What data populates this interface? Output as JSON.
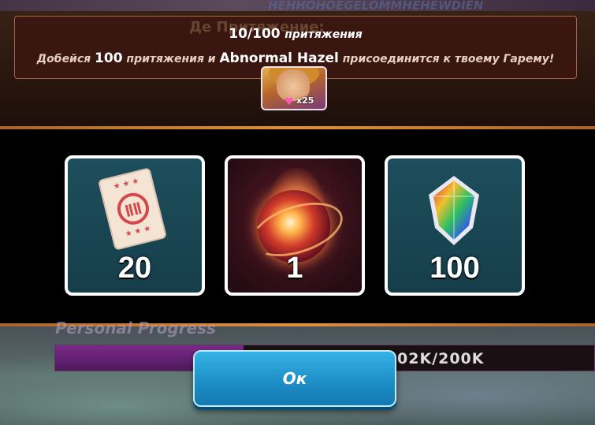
{
  "background": {
    "header_text": "HEHHOHOEGELOMMHEHEWDIEN",
    "banner_ghost_title": "Де      Притяжение:",
    "progress_label": "Personal Progress",
    "progress_value": "02K/200K",
    "progress_fraction": 0.35
  },
  "objective": {
    "current": "10/100",
    "title_word": "притяжения",
    "text_prefix": "Добейся",
    "text_amount": "100",
    "text_middle": "притяжения и",
    "character_name": "Abnormal Hazel",
    "text_suffix": "присоединится к твоему Гарему!",
    "avatar_multiplier": "x25"
  },
  "rewards": [
    {
      "name": "ticket",
      "icon": "ticket-icon",
      "quantity": "20"
    },
    {
      "name": "orb",
      "icon": "fire-orb-icon",
      "quantity": "1"
    },
    {
      "name": "gem",
      "icon": "rainbow-gem-icon",
      "quantity": "100"
    }
  ],
  "ok_button_label": "Ок",
  "colors": {
    "accent": "#1e8fc8",
    "banner_bg": "#3a1610",
    "card_bg": "#1d4e5c"
  }
}
